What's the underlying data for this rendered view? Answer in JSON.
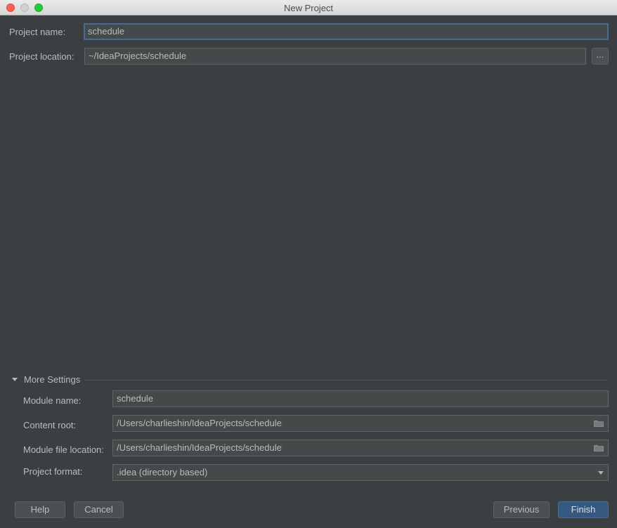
{
  "window": {
    "title": "New Project"
  },
  "project": {
    "name_label": "Project name:",
    "name_value": "schedule",
    "location_label": "Project location:",
    "location_value": "~/IdeaProjects/schedule",
    "browse_label": "..."
  },
  "more_settings": {
    "label": "More Settings",
    "module_name_label": "Module name:",
    "module_name_value": "schedule",
    "content_root_label": "Content root:",
    "content_root_value": "/Users/charlieshin/IdeaProjects/schedule",
    "module_file_label": "Module file location:",
    "module_file_value": "/Users/charlieshin/IdeaProjects/schedule",
    "format_label": "Project format:",
    "format_value": ".idea (directory based)"
  },
  "buttons": {
    "help": "Help",
    "cancel": "Cancel",
    "previous": "Previous",
    "finish": "Finish"
  },
  "colors": {
    "background": "#3c3f41",
    "field_bg": "#45494a",
    "focus_border": "#466d94",
    "primary_button": "#365880"
  },
  "icons": {
    "folder": "folder-icon",
    "dropdown": "chevron-down-icon",
    "expand": "triangle-down-icon"
  }
}
